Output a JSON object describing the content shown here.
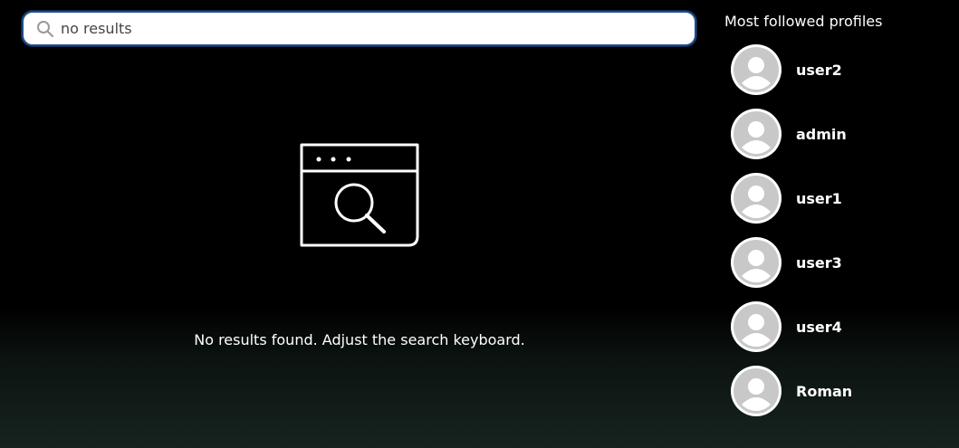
{
  "search": {
    "value": "no results",
    "icon": "search-icon"
  },
  "main": {
    "empty_icon": "browser-search-icon",
    "empty_message": "No results found. Adjust the search keyboard."
  },
  "sidebar": {
    "title": "Most followed profiles",
    "profiles": [
      {
        "name": "user2",
        "avatar_icon": "default-avatar-icon"
      },
      {
        "name": "admin",
        "avatar_icon": "default-avatar-icon"
      },
      {
        "name": "user1",
        "avatar_icon": "default-avatar-icon"
      },
      {
        "name": "user3",
        "avatar_icon": "default-avatar-icon"
      },
      {
        "name": "user4",
        "avatar_icon": "default-avatar-icon"
      },
      {
        "name": "Roman",
        "avatar_icon": "default-avatar-icon"
      }
    ]
  },
  "colors": {
    "background": "#000000",
    "search_border": "#1f4d8f",
    "avatar_fill": "#c8c8c8"
  }
}
